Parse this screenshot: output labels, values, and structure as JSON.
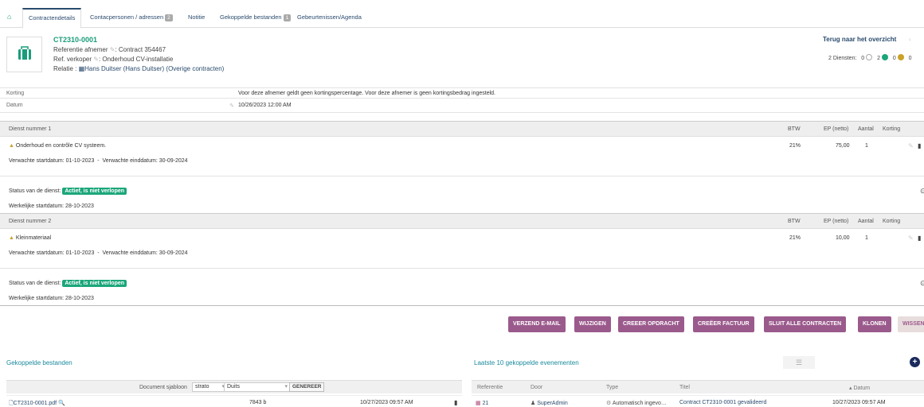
{
  "tabs": [
    {
      "label": "Contractendetails"
    },
    {
      "label": "Contacpersonen / adressen",
      "badge": "2"
    },
    {
      "label": "Notitie"
    },
    {
      "label": "Gekoppelde bestanden",
      "badge": "1"
    },
    {
      "label": "Gebeurtenissen/Agenda"
    }
  ],
  "header": {
    "contract_id": "CT2310-0001",
    "ref_afnemer": "Referentie afnemer",
    "ref_afnemer_value": ": Contract 354467",
    "ref_verkoper": "Ref. verkoper",
    "ref_verkoper_value": ": Onderhoud CV-installatie",
    "relatie_label": "Relatie :",
    "relatie_value": "Hans Duitser (Hans Duitser)",
    "overige_link": "(Overige contracten)",
    "back_link": "Terug naar het overzicht",
    "diensten_label": "2 Diensten:",
    "count_a": "0",
    "count_b": "2",
    "count_c": "0",
    "count_d": "0"
  },
  "fields": {
    "korting_label": "Korting",
    "korting_value": "Voor deze afnemer geldt geen kortingspercentage. Voor deze afnemer is geen kortingsbedrag ingesteld.",
    "datum_label": "Datum",
    "datum_value": "10/26/2023 12:00 AM"
  },
  "services": [
    {
      "title": "Dienst nummer 1",
      "col_btw": "BTW",
      "col_ep": "EP (netto)",
      "col_aantal": "Aantal",
      "col_korting": "Korting",
      "name": "Onderhoud en contrôle CV systeem.",
      "btw": "21%",
      "ep": "75,00",
      "aantal": "1",
      "dates": "Verwachte startdatum: 01-10-2023  -  Verwachte einddatum: 30-09-2024",
      "status_label": "Status van de dienst:",
      "status": "Actief, is niet verlopen",
      "actual": "Werkelijke startdatum: 28-10-2023"
    },
    {
      "title": "Dienst nummer 2",
      "col_btw": "BTW",
      "col_ep": "EP (netto)",
      "col_aantal": "Aantal",
      "col_korting": "Korting",
      "name": "Kleinmateriaal",
      "btw": "21%",
      "ep": "10,00",
      "aantal": "1",
      "dates": "Verwachte startdatum: 01-10-2023  -  Verwachte einddatum: 30-09-2024",
      "status_label": "Status van de dienst:",
      "status": "Actief, is niet verlopen",
      "actual": "Werkelijke startdatum: 28-10-2023"
    }
  ],
  "buttons": {
    "email": "VERZEND E-MAIL",
    "wijzigen": "WIJZIGEN",
    "opdracht": "CREEER OPDRACHT",
    "factuur": "CREËER FACTUUR",
    "sluit": "SLUIT ALLE CONTRACTEN",
    "klonen": "KLONEN",
    "wissen": "WISSEN"
  },
  "files": {
    "title": "Gekoppelde bestanden",
    "template_label": "Document sjabloon",
    "template_value": "strato",
    "lang_value": "Duits",
    "generate": "GENEREER",
    "file_name": "CT2310-0001.pdf",
    "file_size": "7843 b",
    "file_date": "10/27/2023 09:57 AM"
  },
  "events": {
    "title": "Laatste 10 gekoppelde evenementen",
    "col_ref": "Referentie",
    "col_door": "Door",
    "col_type": "Type",
    "col_titel": "Titel",
    "col_datum": "Datum",
    "ref": "21",
    "door": "SuperAdmin",
    "type": "Automatisch ingevo…",
    "titel": "Contract CT2310-0001 gevalideerd",
    "datum": "10/27/2023 09:57 AM"
  }
}
